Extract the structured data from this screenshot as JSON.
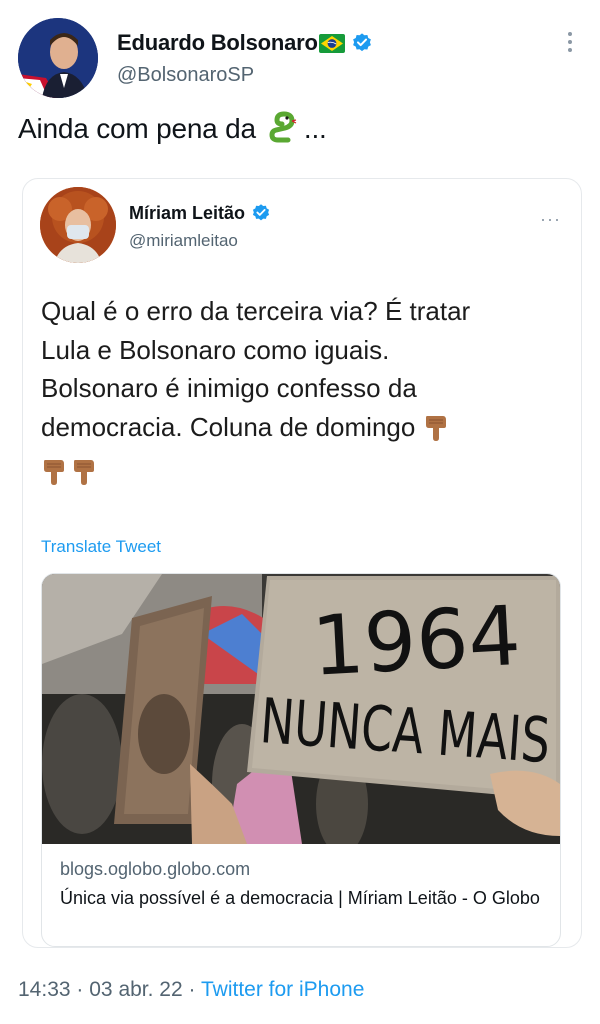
{
  "tweet": {
    "author_name": "Eduardo Bolsonaro",
    "author_handle": "@BolsonaroSP",
    "text_before_emoji": "Ainda com pena da",
    "text_after_emoji": "...",
    "emoji_icon": "snake-icon",
    "timestamp": "14:33",
    "separator": "·",
    "date": "03 abr. 22",
    "source": "Twitter for iPhone"
  },
  "quoted_tweet": {
    "author_name": "Míriam Leitão",
    "author_handle": "@miriamleitao",
    "more_label": "···",
    "text_lines": [
      "Qual é o erro da terceira via? É tratar",
      "Lula e Bolsonaro como iguais.",
      "Bolsonaro é inimigo confesso da",
      "democracia. Coluna de domingo"
    ],
    "translate_label": "Translate Tweet",
    "card": {
      "sign_year": "1964",
      "sign_text": "NUNCA MAIS",
      "domain": "blogs.oglobo.globo.com",
      "title": "Única via possível é a democracia | Míriam Leitão - O Globo"
    }
  },
  "colors": {
    "link_blue": "#1d9bf0",
    "secondary_text": "#536471",
    "verified_blue": "#1d9bf0"
  }
}
